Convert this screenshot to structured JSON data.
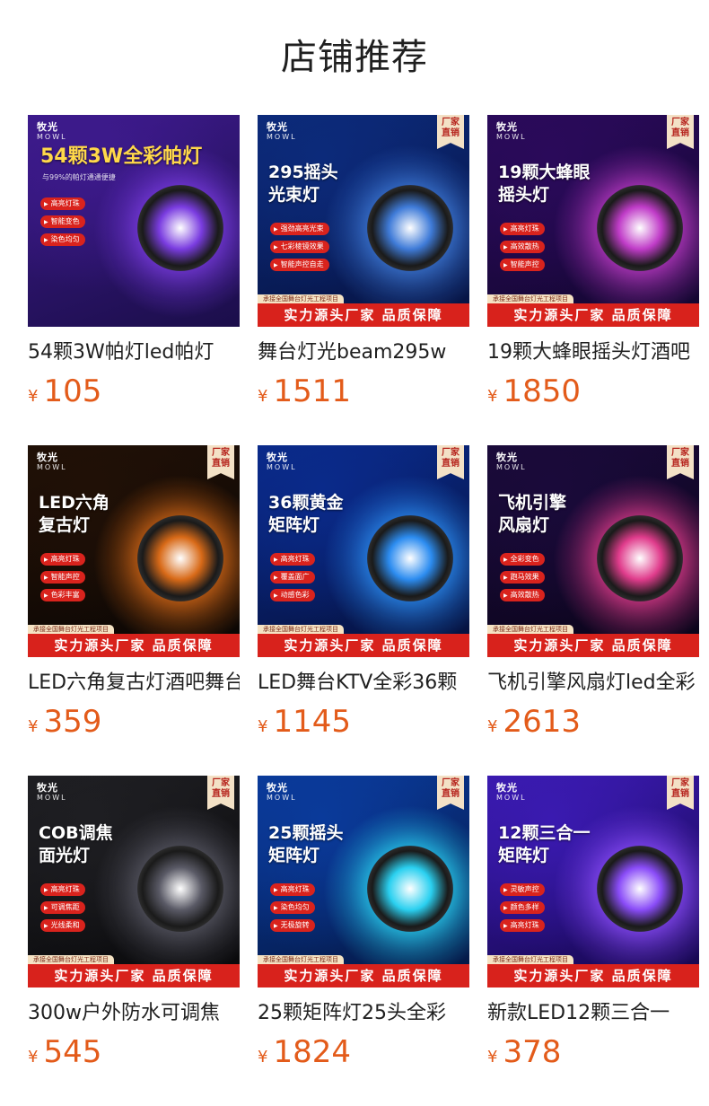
{
  "page_title": "店铺推荐",
  "products": [
    {
      "name": "54颗3W帕灯led帕灯",
      "currency": "¥",
      "price": "105",
      "image": {
        "brand": "牧光",
        "brand_sub": "MOWL",
        "headline": "54颗3W全彩帕灯",
        "sub": "与99%的帕灯通通便捷",
        "features": [
          "高亮灯珠",
          "智能变色",
          "染色均匀"
        ],
        "badge": "",
        "footer_small": "",
        "footer": "",
        "colors": [
          "#3d1a8c",
          "#1b0e4a",
          "#7a3ce0"
        ]
      }
    },
    {
      "name": "舞台灯光beam295w",
      "currency": "¥",
      "price": "1511",
      "image": {
        "brand": "牧光",
        "brand_sub": "MOWL",
        "headline": "295摇头\n光束灯",
        "sub": "",
        "features": [
          "强劲高亮光束",
          "七彩棱镜效果",
          "智能声控自走"
        ],
        "badge": "厂家\n直销",
        "footer_small": "承接全国舞台灯光工程项目",
        "footer": "实力源头厂家 品质保障",
        "colors": [
          "#0c2a7a",
          "#061240",
          "#3f7bd8"
        ]
      }
    },
    {
      "name": "19颗大蜂眼摇头灯酒吧",
      "currency": "¥",
      "price": "1850",
      "image": {
        "brand": "牧光",
        "brand_sub": "MOWL",
        "headline": "19颗大蜂眼\n摇头灯",
        "sub": "",
        "features": [
          "高亮灯珠",
          "高效散热",
          "智能声控"
        ],
        "badge": "厂家\n直销",
        "footer_small": "承接全国舞台灯光工程项目",
        "footer": "实力源头厂家 品质保障",
        "colors": [
          "#2a0a5a",
          "#12062e",
          "#c03cc8"
        ]
      }
    },
    {
      "name": "LED六角复古灯酒吧舞台",
      "currency": "¥",
      "price": "359",
      "image": {
        "brand": "牧光",
        "brand_sub": "MOWL",
        "headline": "LED六角\n复古灯",
        "sub": "",
        "features": [
          "高亮灯珠",
          "智能声控",
          "色彩丰富"
        ],
        "badge": "厂家\n直销",
        "footer_small": "承接全国舞台灯光工程项目",
        "footer": "实力源头厂家 品质保障",
        "colors": [
          "#201006",
          "#0a0604",
          "#d86a18"
        ]
      }
    },
    {
      "name": "LED舞台KTV全彩36颗",
      "currency": "¥",
      "price": "1145",
      "image": {
        "brand": "牧光",
        "brand_sub": "MOWL",
        "headline": "36颗黄金\n矩阵灯",
        "sub": "",
        "features": [
          "高亮灯珠",
          "覆盖面广",
          "动感色彩"
        ],
        "badge": "厂家\n直销",
        "footer_small": "承接全国舞台灯光工程项目",
        "footer": "实力源头厂家 品质保障",
        "colors": [
          "#0a2a8a",
          "#05103a",
          "#2c8cf0"
        ]
      }
    },
    {
      "name": "飞机引擎风扇灯led全彩",
      "currency": "¥",
      "price": "2613",
      "image": {
        "brand": "牧光",
        "brand_sub": "MOWL",
        "headline": "飞机引擎\n风扇灯",
        "sub": "",
        "features": [
          "全彩变色",
          "跑马效果",
          "高效散热"
        ],
        "badge": "厂家\n直销",
        "footer_small": "承接全国舞台灯光工程项目",
        "footer": "实力源头厂家 品质保障",
        "colors": [
          "#1a0a3a",
          "#0a0418",
          "#e03c8c"
        ]
      }
    },
    {
      "name": "300w户外防水可调焦",
      "currency": "¥",
      "price": "545",
      "image": {
        "brand": "牧光",
        "brand_sub": "MOWL",
        "headline": "COB调焦\n面光灯",
        "sub": "",
        "features": [
          "高亮灯珠",
          "可调焦距",
          "光线柔和"
        ],
        "badge": "厂家\n直销",
        "footer_small": "承接全国舞台灯光工程项目",
        "footer": "实力源头厂家 品质保障",
        "colors": [
          "#1e1e22",
          "#08080a",
          "#5a5a66"
        ]
      }
    },
    {
      "name": "25颗矩阵灯25头全彩",
      "currency": "¥",
      "price": "1824",
      "image": {
        "brand": "牧光",
        "brand_sub": "MOWL",
        "headline": "25颗摇头\n矩阵灯",
        "sub": "",
        "features": [
          "高亮灯珠",
          "染色均匀",
          "无极旋转"
        ],
        "badge": "厂家\n直销",
        "footer_small": "承接全国舞台灯光工程项目",
        "footer": "实力源头厂家 品质保障",
        "colors": [
          "#0a3a9a",
          "#041640",
          "#2ad0f0"
        ]
      }
    },
    {
      "name": "新款LED12颗三合一",
      "currency": "¥",
      "price": "378",
      "image": {
        "brand": "牧光",
        "brand_sub": "MOWL",
        "headline": "12颗三合一\n矩阵灯",
        "sub": "",
        "features": [
          "灵敏声控",
          "颜色多样",
          "高亮灯珠"
        ],
        "badge": "厂家\n直销",
        "footer_small": "承接全国舞台灯光工程项目",
        "footer": "实力源头厂家 品质保障",
        "colors": [
          "#3a1ab0",
          "#14064a",
          "#8a4cf8"
        ]
      }
    }
  ]
}
